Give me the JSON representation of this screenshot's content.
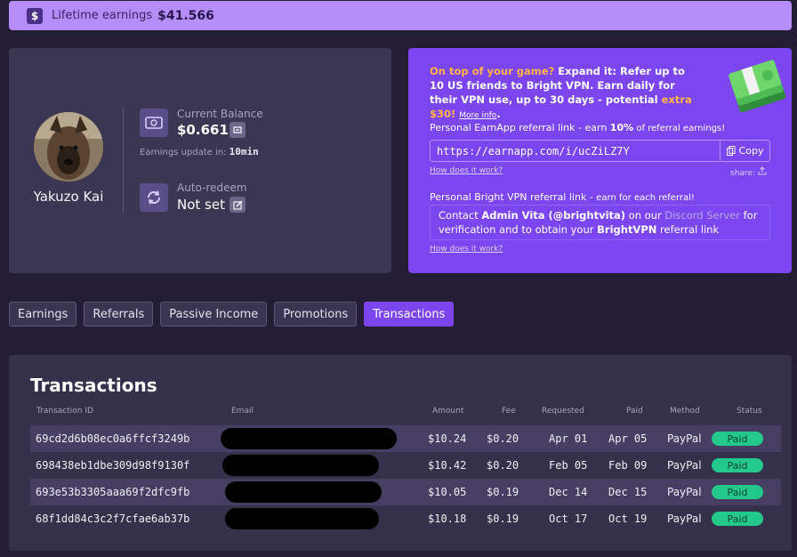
{
  "banner": {
    "label": "Lifetime earnings",
    "value": "$41.566",
    "icon": "dollar-icon"
  },
  "profile": {
    "username": "Yakuzo Kai",
    "balance_label": "Current Balance",
    "balance_value": "$0.661",
    "update_prefix": "Earnings update in:",
    "update_value": "10min",
    "redeem_label": "Auto-redeem",
    "redeem_value": "Not set"
  },
  "promo": {
    "lead": "On top of your game?",
    "text": " Expand it: Refer up to 10 US friends to Bright VPN. Earn daily for their VPN use, up to 30 days - potential ",
    "highlight": "extra $30!",
    "more": "More info",
    "more_suffix": ".",
    "earnapp_label": "Personal EarnApp referral link - earn ",
    "earnapp_pct": "10%",
    "earnapp_suffix": " of referral earnings!",
    "referral_url": "https://earnapp.com/i/ucZiLZ7Y",
    "copy_label": "Copy",
    "how1": "How does it work?",
    "share": "share:",
    "vpn_label": "Personal Bright VPN referral link - ",
    "vpn_suffix": "earn for each referral!",
    "vpn_contact_1": "Contact ",
    "vpn_admin": "Admin Vita (@brightvita)",
    "vpn_contact_2": " on our ",
    "vpn_discord": "Discord Server",
    "vpn_contact_3": " for verification and to obtain your ",
    "vpn_brand": "BrightVPN",
    "vpn_contact_4": " referral link",
    "how2": "How does it work?"
  },
  "tabs": [
    "Earnings",
    "Referrals",
    "Passive Income",
    "Promotions",
    "Transactions"
  ],
  "active_tab": "Transactions",
  "transactions": {
    "title": "Transactions",
    "headers": {
      "id": "Transaction ID",
      "email": "Email",
      "amount": "Amount",
      "fee": "Fee",
      "requested": "Requested",
      "paid": "Paid",
      "method": "Method",
      "status": "Status"
    },
    "rows": [
      {
        "id": "69cd2d6b08ec0a6ffcf3249b",
        "amount": "$10.24",
        "fee": "$0.20",
        "requested": "Apr 01",
        "paid": "Apr 05",
        "method": "PayPal",
        "status": "Paid"
      },
      {
        "id": "698438eb1dbe309d98f9130f",
        "amount": "$10.42",
        "fee": "$0.20",
        "requested": "Feb 05",
        "paid": "Feb 09",
        "method": "PayPal",
        "status": "Paid"
      },
      {
        "id": "693e53b3305aaa69f2dfc9fb",
        "amount": "$10.05",
        "fee": "$0.19",
        "requested": "Dec 14",
        "paid": "Dec 15",
        "method": "PayPal",
        "status": "Paid"
      },
      {
        "id": "68f1dd84c3c2f7cfae6ab37b",
        "amount": "$10.18",
        "fee": "$0.19",
        "requested": "Oct 17",
        "paid": "Oct 19",
        "method": "PayPal",
        "status": "Paid"
      }
    ]
  },
  "colors": {
    "accent": "#7b45f0",
    "paid": "#22c98a",
    "banner": "#b58df7"
  }
}
